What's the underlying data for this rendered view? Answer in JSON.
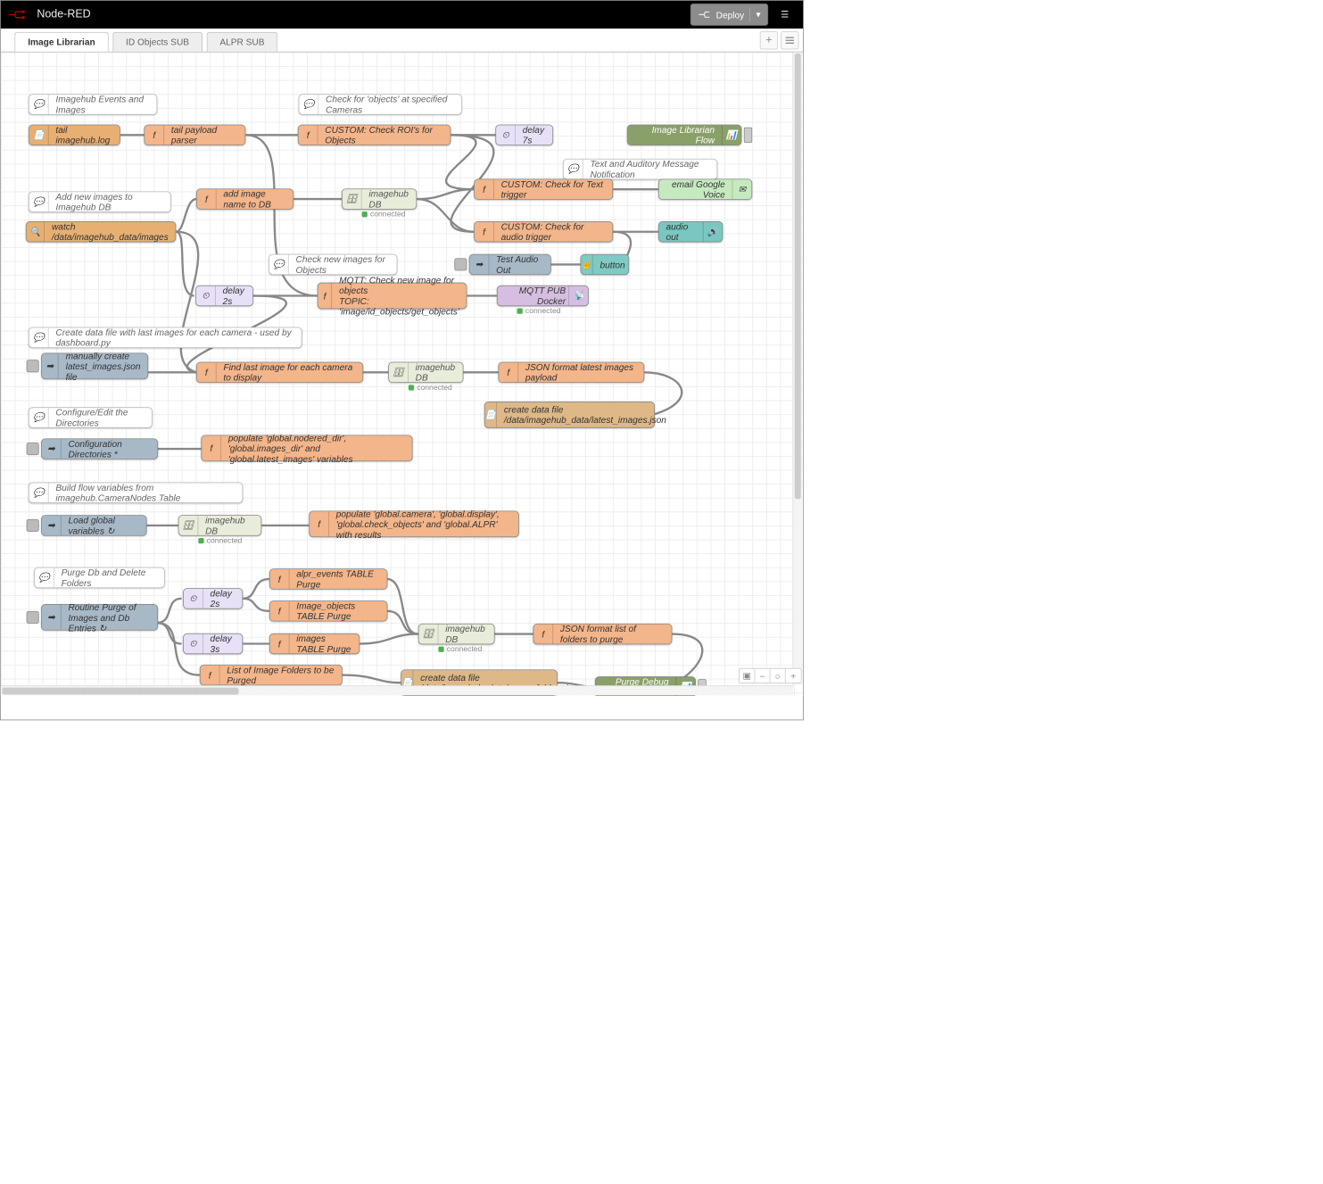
{
  "header": {
    "title": "Node-RED",
    "deploy": "Deploy"
  },
  "tabs": [
    {
      "label": "Image Librarian",
      "active": true
    },
    {
      "label": "ID Objects SUB",
      "active": false
    },
    {
      "label": "ALPR SUB",
      "active": false
    }
  ],
  "nodes": {
    "c_events": "Imagehub Events and Images",
    "c_roi": "Check for 'objects' at specified Cameras",
    "tail": "tail imagehub.log",
    "tailparser": "tail payload parser",
    "checkroi": "CUSTOM: Check ROI's for Objects",
    "delay7": "delay 7s",
    "librarianflow": "Image Librarian Flow",
    "c_notify": "Text and Auditory Message Notification",
    "c_addimages": "Add new images to Imagehub DB",
    "addimagedb": "add image name to DB",
    "imagehubdb1": "imagehub DB",
    "checktext": "CUSTOM: Check for Text trigger",
    "email": "email Google Voice",
    "watch": "watch /data/imagehub_data/images",
    "checkaudio": "CUSTOM: Check for audio trigger",
    "audioout": "audio out",
    "c_checknew": "Check new images for Objects",
    "testaudio": "Test Audio Out",
    "button": "button",
    "delay2": "delay 2s",
    "mqttfunc": "MQTT: Check new image for objects\nTOPIC: 'image/id_objects/get_objects'",
    "mqttpub": "MQTT PUB Docker",
    "c_createdata": "Create data file with last images for each camera - used by dashboard.py",
    "manualcreate": "manually create\nlatest_images.json file",
    "findlast": "Find last image for each camera to display",
    "imagehubdb2": "imagehub DB",
    "jsonlatest": "JSON format latest images payload",
    "createlatest": "create data file\n/data/imagehub_data/latest_images.json",
    "c_configure": "Configure/Edit the Directories",
    "configdirs": "Configuration Directories *",
    "populate1": "populate 'global.nodered_dir', 'global.images_dir' and\n'global.latest_images' variables",
    "c_buildflow": "Build flow variables from imagehub.CameraNodes Table",
    "loadglobal": "Load global variables ↻",
    "imagehubdb3": "imagehub DB",
    "populate2": "populate 'global.camera', 'global.display',\n'global.check_objects' and 'global.ALPR' with results",
    "c_purge": "Purge Db and Delete Folders",
    "routinepurge": "Routine Purge of\nImages and Db Entries ↻",
    "delay2b": "delay 2s",
    "delay3": "delay 3s",
    "alprpurge": "alpr_events TABLE Purge",
    "imgobjpurge": "Image_objects TABLE Purge",
    "imagespurge": "images TABLE Purge",
    "listpurge": "List of Image Folders to be Purged",
    "imagehubdb4": "imagehub DB",
    "jsonpurge": "JSON format list of folders to purge",
    "createpurge": "create data file\n/data/imagehub_data/purge_folders.json",
    "purgedebug": "Purge Debug Node"
  },
  "status": {
    "connected": "connected"
  }
}
